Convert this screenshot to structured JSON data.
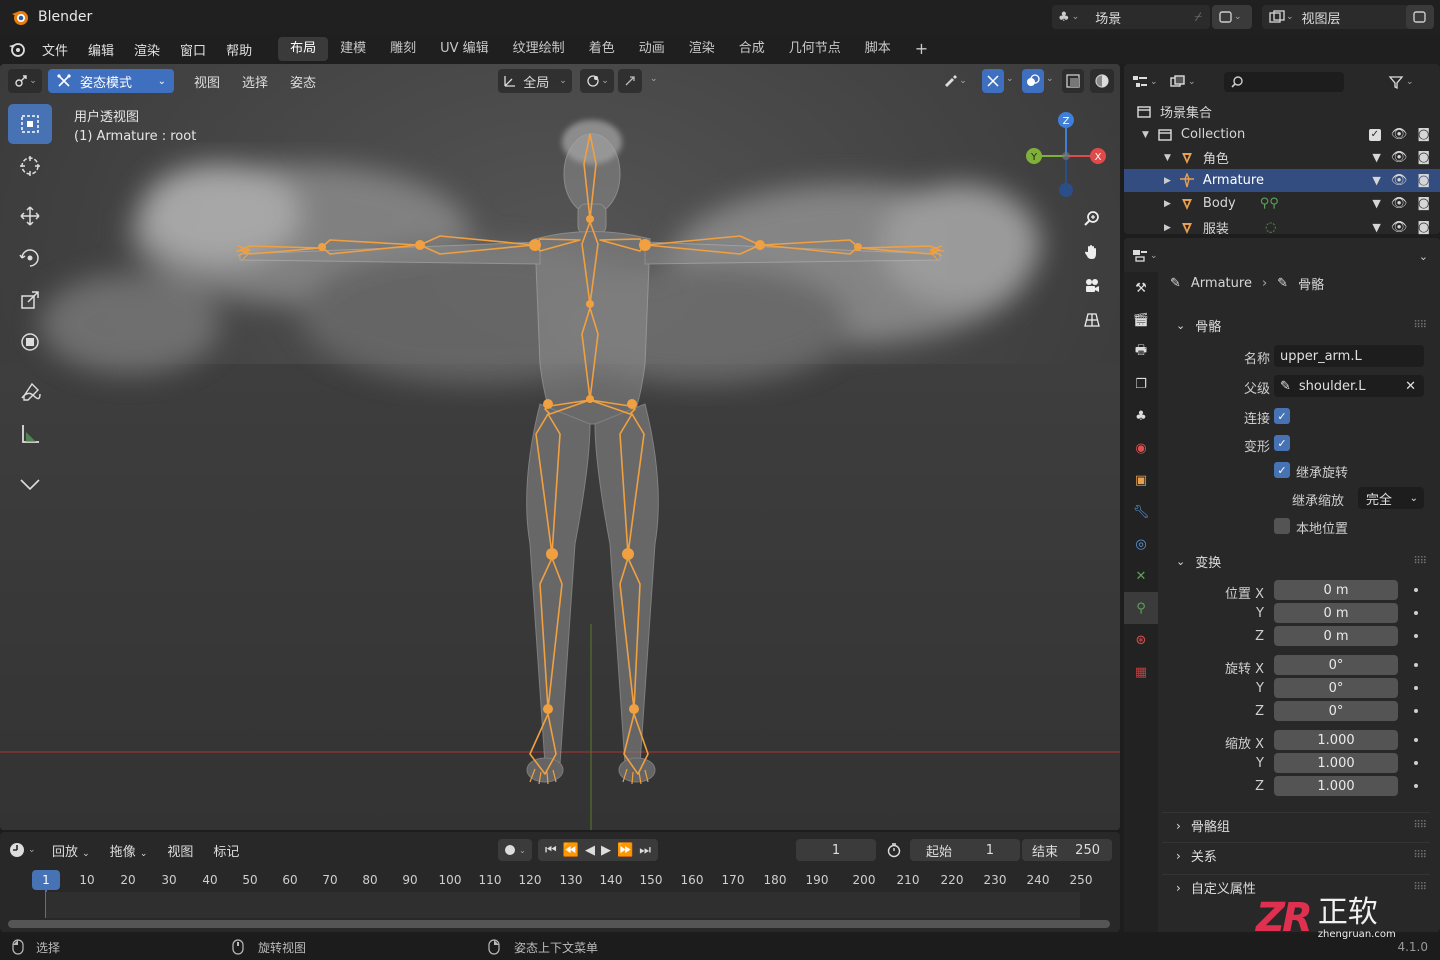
{
  "app": {
    "title": "Blender",
    "version": "4.1.0",
    "scene_label": "场景",
    "view_layer_label": "视图层"
  },
  "menu": {
    "items": [
      "文件",
      "编辑",
      "渲染",
      "窗口",
      "帮助"
    ],
    "workspaces": [
      "布局",
      "建模",
      "雕刻",
      "UV 编辑",
      "纹理绘制",
      "着色",
      "动画",
      "渲染",
      "合成",
      "几何节点",
      "脚本"
    ],
    "active_workspace": "布局",
    "add_tab": "+"
  },
  "viewport": {
    "mode": "姿态模式",
    "menus": [
      "视图",
      "选择",
      "姿态"
    ],
    "orientation": "全局",
    "view_name": "用户透视图",
    "object_info": "(1) Armature : root",
    "gizmo_axes": {
      "x": "X",
      "y": "Y",
      "z": "Z"
    }
  },
  "timeline": {
    "menus": [
      "回放",
      "拖像",
      "视图",
      "标记"
    ],
    "current_frame": "1",
    "start_label": "起始",
    "start_value": "1",
    "end_label": "结束",
    "end_value": "250",
    "ruler_current": "1",
    "ruler_ticks": [
      "10",
      "20",
      "30",
      "40",
      "50",
      "60",
      "70",
      "80",
      "90",
      "100",
      "110",
      "120",
      "130",
      "140",
      "150",
      "160",
      "170",
      "180",
      "190",
      "200",
      "210",
      "220",
      "230",
      "240",
      "250"
    ]
  },
  "status": {
    "select": "选择",
    "rotate_view": "旋转视图",
    "context_menu": "姿态上下文菜单"
  },
  "outliner": {
    "root": "场景集合",
    "rows": [
      {
        "label": "Collection"
      },
      {
        "label": "角色"
      },
      {
        "label": "Armature"
      },
      {
        "label": "Body"
      },
      {
        "label": "服装"
      }
    ]
  },
  "properties": {
    "breadcrumb_object": "Armature",
    "breadcrumb_data": "骨骼",
    "bone_panel": "骨骼",
    "name_label": "名称",
    "name_value": "upper_arm.L",
    "parent_label": "父级",
    "parent_value": "shoulder.L",
    "connect_label": "连接",
    "deform_label": "变形",
    "inherit_rotation_label": "继承旋转",
    "inherit_scale_label": "继承缩放",
    "inherit_scale_value": "完全",
    "local_location_label": "本地位置",
    "transform_panel": "变换",
    "location_label": "位置 X",
    "rotation_label": "旋转 X",
    "scale_label": "缩放 X",
    "axis_y": "Y",
    "axis_z": "Z",
    "location": [
      "0 m",
      "0 m",
      "0 m"
    ],
    "rotation": [
      "0°",
      "0°",
      "0°"
    ],
    "scale": [
      "1.000",
      "1.000",
      "1.000"
    ],
    "bone_groups_panel": "骨骼组",
    "relations_panel": "关系",
    "custom_props_panel": "自定义属性"
  },
  "watermark": {
    "logo": "ZR",
    "name": "正软",
    "url": "zhengruan.com"
  },
  "colors": {
    "accent": "#4772b3",
    "bone": "#f0a040",
    "axis_x": "#e04a4a",
    "axis_y": "#7fb03a",
    "axis_z": "#3f7fd9",
    "selected_row": "#334d80"
  }
}
